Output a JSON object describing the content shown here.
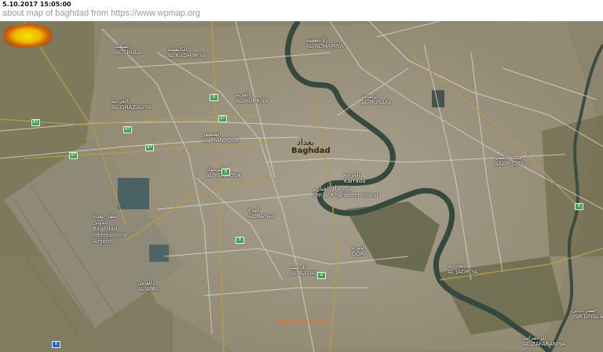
{
  "header": {
    "timestamp": "5.10.2017 15:05:00",
    "caption": "about map of baghdad from https://www.wpmap.org"
  },
  "map": {
    "city_name_ar": "بغداد",
    "city_name_en": "Baghdad",
    "watermark": "www.wpmap.org",
    "labels": [
      {
        "id": "al-kadhimiya",
        "text": "AL KADHIMIYA",
        "ar": "الكاظمية"
      },
      {
        "id": "al-mansour",
        "text": "AL MANSOUR",
        "ar": "المنصور"
      },
      {
        "id": "al-karada",
        "text": "Karrada",
        "ar": "الكرادة"
      },
      {
        "id": "al-adhamiya",
        "text": "AL ADHAMIYA",
        "ar": "الأعظمية"
      },
      {
        "id": "sadr-city",
        "text": "SADR CITY",
        "ar": "مدينة الصدر"
      },
      {
        "id": "um-al-khanazeer",
        "text": "Um Al-Khanazeer Island",
        "ar": "جزيرة أم الخنازير"
      },
      {
        "id": "al-dora",
        "text": "DORA",
        "ar": "الدورة"
      },
      {
        "id": "baghdad-airport",
        "text": "Baghdad International Airport",
        "ar": "مطار بغداد الدولي"
      },
      {
        "id": "al-ghazaliya",
        "text": "AL GHAZALIYA",
        "ar": "الغزالية"
      },
      {
        "id": "al-yarmouk",
        "text": "AL YARMOUK",
        "ar": "اليرموك"
      },
      {
        "id": "al-bayaa",
        "text": "AL BAYAA",
        "ar": "البياع"
      },
      {
        "id": "al-rashid",
        "text": "AL RASHID",
        "ar": "الرشيد"
      },
      {
        "id": "jisr-diyala",
        "text": "JISR DIYALA",
        "ar": "جسر ديالى"
      },
      {
        "id": "al-zafaraniya",
        "text": "AL ZAFARANIYA",
        "ar": "الزعفرانية"
      },
      {
        "id": "al-amil",
        "text": "AL AMIL",
        "ar": "العامل"
      },
      {
        "id": "al-shula",
        "text": "AL SHULA",
        "ar": "الشعلة"
      },
      {
        "id": "al-rusafa",
        "text": "AL RUSAFA",
        "ar": "الرصافة"
      },
      {
        "id": "al-jadriya",
        "text": "AL JADRIYA",
        "ar": "الجادرية"
      },
      {
        "id": "al-hurriya",
        "text": "AL HURRIYA",
        "ar": "الحرية"
      }
    ],
    "shields": [
      "87",
      "87",
      "87",
      "87",
      "87",
      "8",
      "8",
      "8",
      "8",
      "8",
      "8"
    ]
  }
}
